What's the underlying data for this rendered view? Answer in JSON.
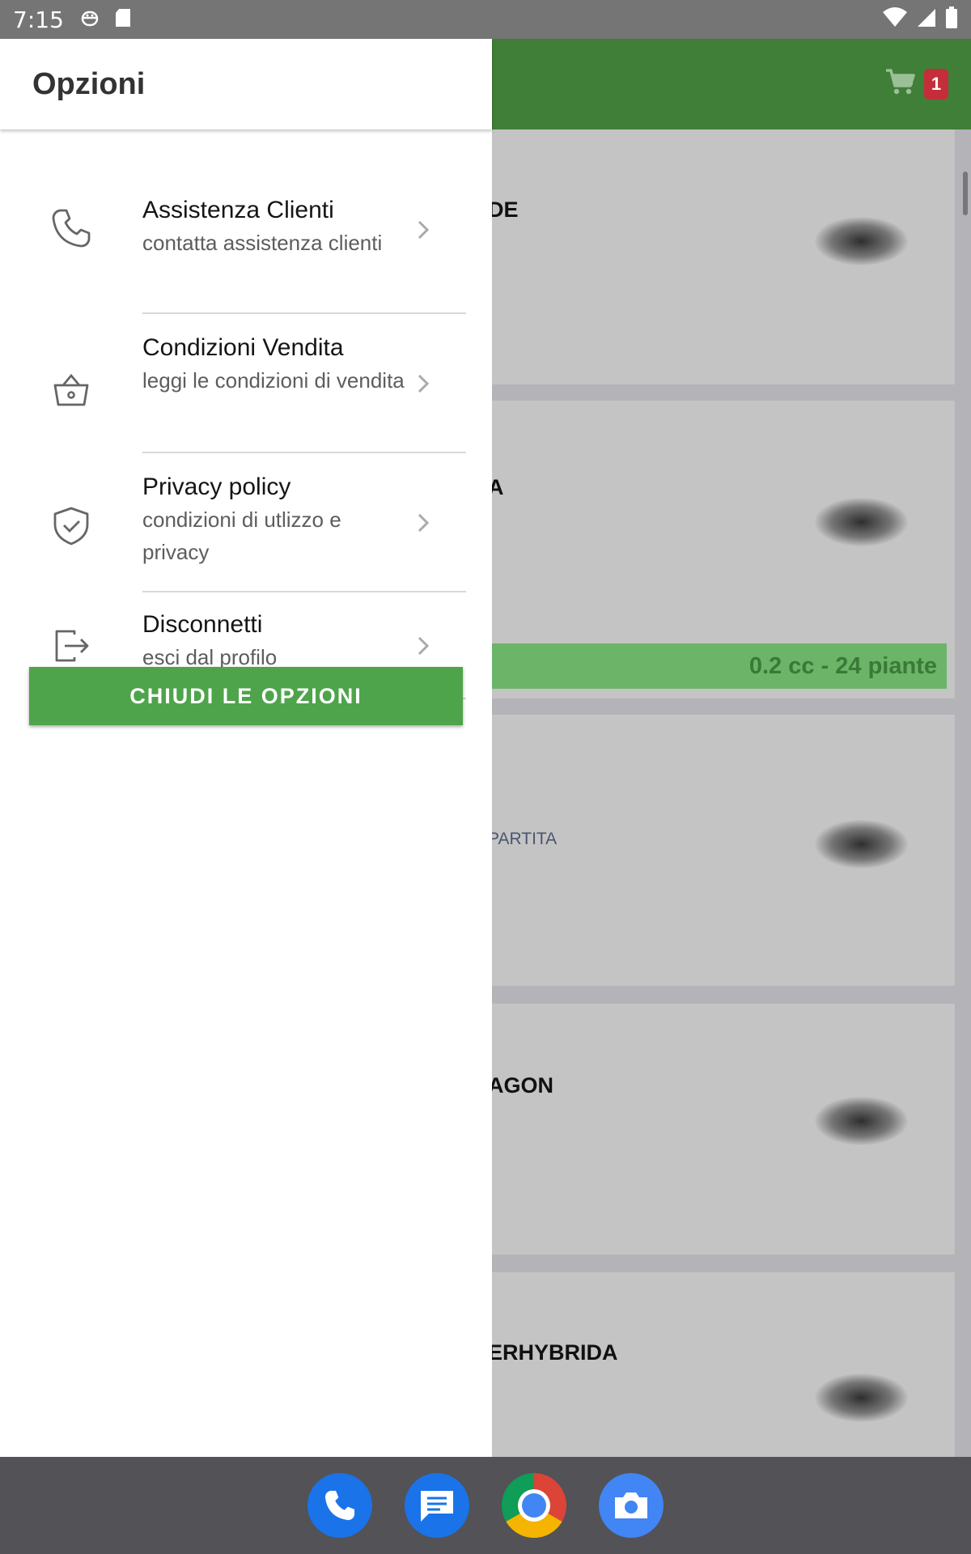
{
  "status_bar": {
    "time": "7:15",
    "left_icons": [
      "android-debug-icon",
      "sd-card-icon"
    ],
    "right_icons": [
      "wifi-icon",
      "cell-signal-icon",
      "battery-icon"
    ]
  },
  "app_bar": {
    "cart_icon": "cart-icon",
    "cart_count": "1",
    "color": "#3f7f37",
    "badge_color": "#c62d3a"
  },
  "drawer": {
    "title": "Opzioni",
    "items": [
      {
        "icon": "phone-icon",
        "title": "Assistenza Clienti",
        "desc": "contatta assistenza clienti"
      },
      {
        "icon": "basket-icon",
        "title": "Condizioni Vendita",
        "desc": "leggi le condizioni di vendita"
      },
      {
        "icon": "shield-check-icon",
        "title": "Privacy policy",
        "desc": "condizioni di utlizzo e privacy"
      },
      {
        "icon": "logout-icon",
        "title": "Disconnetti",
        "desc": "esci dal profilo"
      }
    ],
    "close_label": "CHIUDI LE OPZIONI",
    "close_color": "#4ea44a"
  },
  "background_cards": [
    {
      "title": "DE",
      "sub": ""
    },
    {
      "title": "A",
      "sub": "",
      "qty": "0.2 cc - 24 piante"
    },
    {
      "title": "",
      "sub": "PARTITA"
    },
    {
      "title": "AGON",
      "sub": ""
    },
    {
      "title": "ERHYBRIDA",
      "sub": ""
    }
  ],
  "dock": {
    "apps": [
      "phone-app-icon",
      "messages-app-icon",
      "chrome-app-icon",
      "camera-app-icon"
    ]
  }
}
